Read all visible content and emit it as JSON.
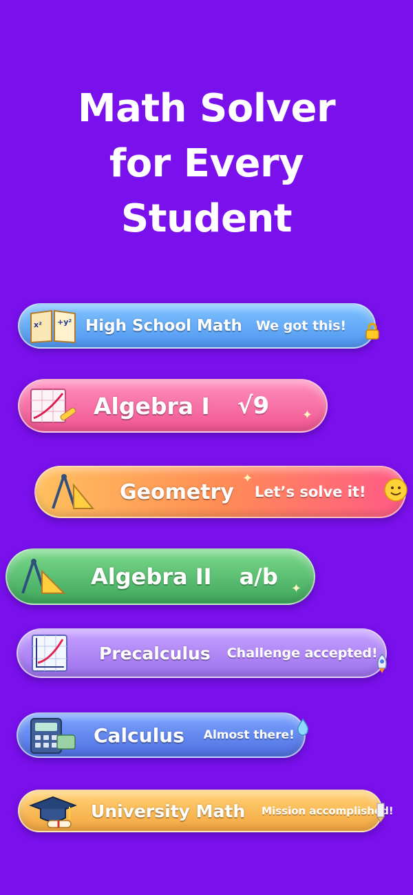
{
  "header": {
    "title_lines": [
      "Math Solver",
      "for Every",
      "Student"
    ]
  },
  "levels": [
    {
      "label": "High School Math",
      "tag": "We got this!",
      "icon": "open-book-icon",
      "end_icon": "lock-icon",
      "color": "#62a8f5"
    },
    {
      "label": "Algebra I",
      "tag": "√9",
      "icon": "graph-paper-icon",
      "end_icon": "",
      "color": "#f56a9e"
    },
    {
      "label": "Geometry",
      "tag": "Let’s solve it!",
      "icon": "compass-ruler-icon",
      "end_icon": "smiley-icon",
      "color": "#ff9a55"
    },
    {
      "label": "Algebra II",
      "tag": "a/b",
      "icon": "compass-ruler-icon",
      "end_icon": "",
      "color": "#52b86a"
    },
    {
      "label": "Precalculus",
      "tag": "Challenge accepted!",
      "icon": "graph-chart-icon",
      "end_icon": "rocket-icon",
      "color": "#ae84f2"
    },
    {
      "label": "Calculus",
      "tag": "Almost there!",
      "icon": "calculator-icon",
      "end_icon": "drop-icon",
      "color": "#6186ea"
    },
    {
      "label": "University Math",
      "tag": "Mission accomplished!",
      "icon": "graduation-cap-icon",
      "end_icon": "pencil-icon",
      "color": "#f8b94f"
    }
  ]
}
